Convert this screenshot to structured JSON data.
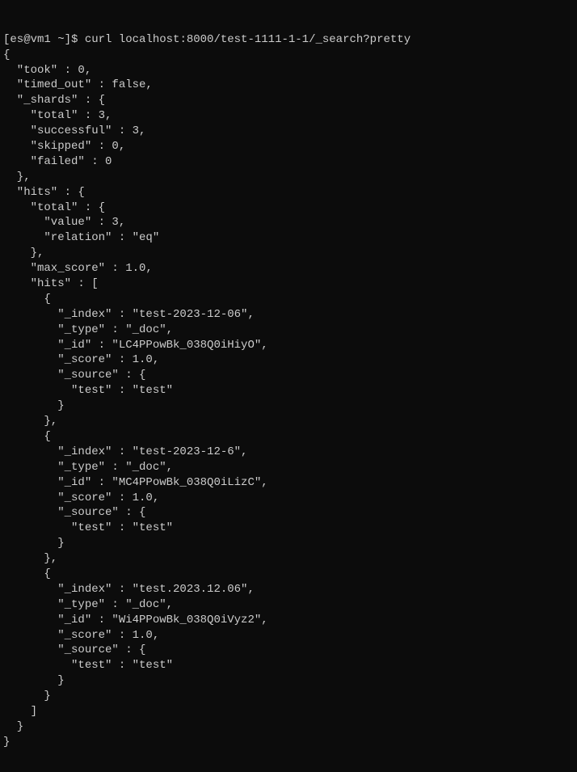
{
  "prompt": {
    "user_host": "[es@vm1 ~]$",
    "command": "curl localhost:8000/test-1111-1-1/_search?pretty"
  },
  "output": [
    "{",
    "  \"took\" : 0,",
    "  \"timed_out\" : false,",
    "  \"_shards\" : {",
    "    \"total\" : 3,",
    "    \"successful\" : 3,",
    "    \"skipped\" : 0,",
    "    \"failed\" : 0",
    "  },",
    "  \"hits\" : {",
    "    \"total\" : {",
    "      \"value\" : 3,",
    "      \"relation\" : \"eq\"",
    "    },",
    "    \"max_score\" : 1.0,",
    "    \"hits\" : [",
    "      {",
    "        \"_index\" : \"test-2023-12-06\",",
    "        \"_type\" : \"_doc\",",
    "        \"_id\" : \"LC4PPowBk_038Q0iHiyO\",",
    "        \"_score\" : 1.0,",
    "        \"_source\" : {",
    "          \"test\" : \"test\"",
    "        }",
    "      },",
    "      {",
    "        \"_index\" : \"test-2023-12-6\",",
    "        \"_type\" : \"_doc\",",
    "        \"_id\" : \"MC4PPowBk_038Q0iLizC\",",
    "        \"_score\" : 1.0,",
    "        \"_source\" : {",
    "          \"test\" : \"test\"",
    "        }",
    "      },",
    "      {",
    "        \"_index\" : \"test.2023.12.06\",",
    "        \"_type\" : \"_doc\",",
    "        \"_id\" : \"Wi4PPowBk_038Q0iVyz2\",",
    "        \"_score\" : 1.0,",
    "        \"_source\" : {",
    "          \"test\" : \"test\"",
    "        }",
    "      }",
    "    ]",
    "  }",
    "}"
  ]
}
